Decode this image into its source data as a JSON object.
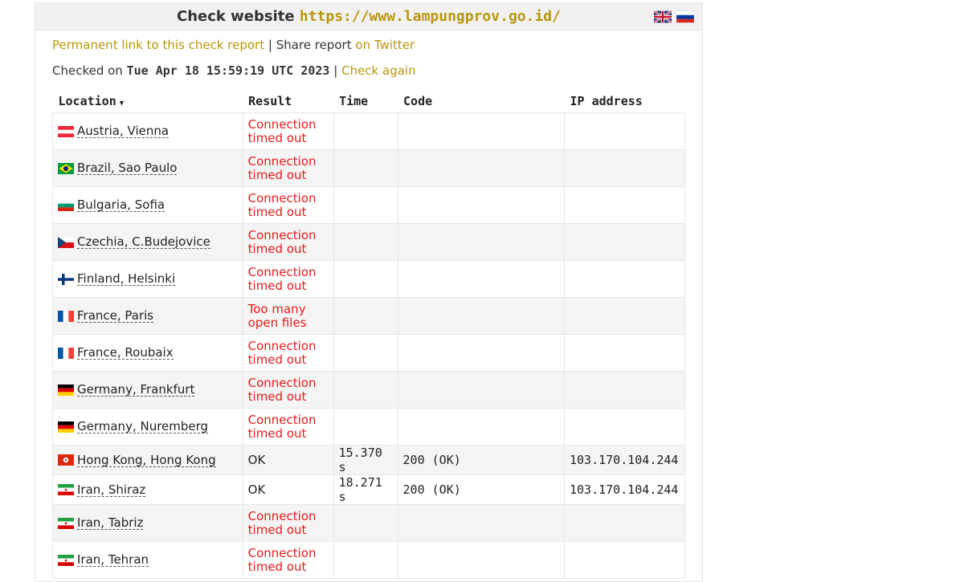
{
  "header": {
    "title_prefix": "Check website",
    "url": "https://www.lampungprov.go.id/"
  },
  "links": {
    "permalink": "Permanent link to this check report",
    "separator": "|",
    "share": "Share report",
    "twitter": "on Twitter"
  },
  "checked": {
    "prefix": "Checked on",
    "datetime": "Tue Apr 18 15:59:19 UTC 2023",
    "separator": "|",
    "check_again": "Check again"
  },
  "table": {
    "headers": {
      "location": "Location",
      "result": "Result",
      "time": "Time",
      "code": "Code",
      "ip": "IP address"
    },
    "rows": [
      {
        "location": "Austria, Vienna",
        "result_line1": "Connection",
        "result_line2": "timed out",
        "time": "",
        "code": "",
        "ip": ""
      },
      {
        "location": "Brazil, Sao Paulo",
        "result_line1": "Connection",
        "result_line2": "timed out",
        "time": "",
        "code": "",
        "ip": ""
      },
      {
        "location": "Bulgaria, Sofia",
        "result_line1": "Connection",
        "result_line2": "timed out",
        "time": "",
        "code": "",
        "ip": ""
      },
      {
        "location": "Czechia, C.Budejovice",
        "result_line1": "Connection",
        "result_line2": "timed out",
        "time": "",
        "code": "",
        "ip": ""
      },
      {
        "location": "Finland, Helsinki",
        "result_line1": "Connection",
        "result_line2": "timed out",
        "time": "",
        "code": "",
        "ip": ""
      },
      {
        "location": "France, Paris",
        "result_line1": "Too many",
        "result_line2": "open files",
        "time": "",
        "code": "",
        "ip": ""
      },
      {
        "location": "France, Roubaix",
        "result_line1": "Connection",
        "result_line2": "timed out",
        "time": "",
        "code": "",
        "ip": ""
      },
      {
        "location": "Germany, Frankfurt",
        "result_line1": "Connection",
        "result_line2": "timed out",
        "time": "",
        "code": "",
        "ip": ""
      },
      {
        "location": "Germany, Nuremberg",
        "result_line1": "Connection",
        "result_line2": "timed out",
        "time": "",
        "code": "",
        "ip": ""
      },
      {
        "location": "Hong Kong, Hong Kong",
        "result": "OK",
        "time": "15.370 s",
        "code": "200 (OK)",
        "ip": "103.170.104.244"
      },
      {
        "location": "Iran, Shiraz",
        "result": "OK",
        "time": "18.271 s",
        "code": "200 (OK)",
        "ip": "103.170.104.244"
      },
      {
        "location": "Iran, Tabriz",
        "result_line1": "Connection",
        "result_line2": "timed out",
        "time": "",
        "code": "",
        "ip": ""
      },
      {
        "location": "Iran, Tehran",
        "result_line1": "Connection",
        "result_line2": "timed out",
        "time": "",
        "code": "",
        "ip": ""
      }
    ]
  },
  "colors": {
    "link": "#b8960c",
    "error": "#e31b1b"
  },
  "icons": {
    "lang": [
      "uk-flag-icon",
      "russia-flag-icon"
    ],
    "sort": "sort-down-icon"
  }
}
